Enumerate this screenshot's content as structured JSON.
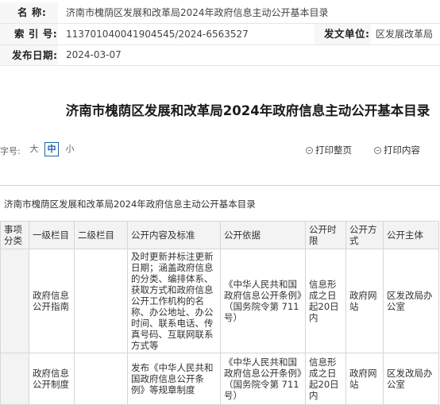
{
  "meta": {
    "name_label": "名    称:",
    "name_value": "济南市槐荫区发展和改革局2024年政府信息主动公开基本目录",
    "index_label": "索 引 号:",
    "index_value": "113701040041904545/2024-6563527",
    "issuer_label": "发文单位:",
    "issuer_value": "区发展改革局",
    "date_label": "发布日期:",
    "date_value": "2024-03-07"
  },
  "title": "济南市槐荫区发展和改革局2024年政府信息主动公开基本目录",
  "toolbar": {
    "font_label": "字号:",
    "font_big": "大",
    "font_mid": "中",
    "font_small": "小",
    "print_page": "打印整页",
    "print_content": "打印内容"
  },
  "table": {
    "caption": "济南市槐荫区发展和改革局2024年政府信息主动公开基本目录",
    "headers": [
      "事项分类",
      "一级栏目",
      "二级栏目",
      "公开内容及标准",
      "公开依据",
      "公开时限",
      "公开方式",
      "公开主体"
    ],
    "rows": [
      {
        "category": "",
        "level1": "政府信息公开指南",
        "level2": "",
        "content": "及时更新并标注更新日期；涵盖政府信息的分类、编排体系、获取方式和政府信息公开工作机构的名称、办公地址、办公时间、联系电话、传真号码、互联网联系方式等",
        "basis": "《中华人民共和国政府信息公开条例》（国务院令第 711 号）",
        "time_limit": "信息形成之日起20日内",
        "method": "政府网站",
        "subject": "区发改局办公室"
      },
      {
        "category": "",
        "level1": "政府信息公开制度",
        "level2": "",
        "content": "发布《中华人民共和国政府信息公开条例》等规章制度",
        "basis": "《中华人民共和国政府信息公开条例》（国务院令第 711 号）",
        "time_limit": "信息形成之日起20日内",
        "method": "政府网站",
        "subject": "区发改局办公室"
      }
    ]
  }
}
